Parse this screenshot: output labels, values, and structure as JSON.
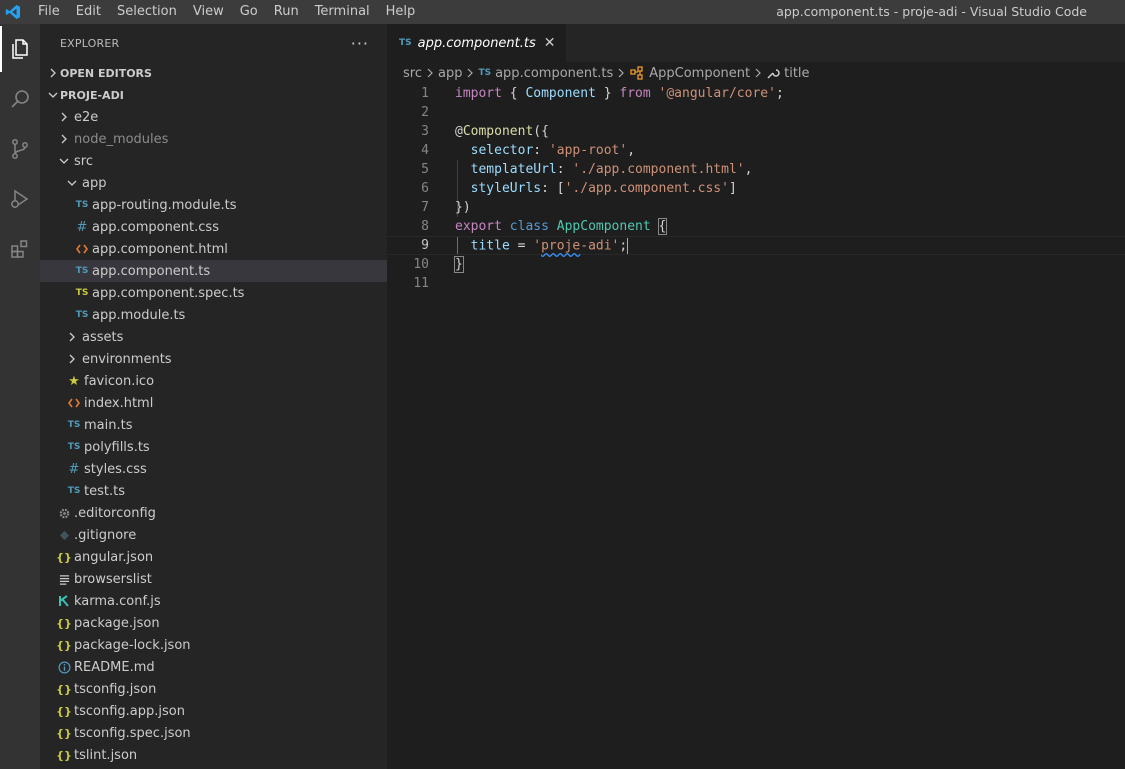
{
  "window": {
    "title": "app.component.ts - proje-adi - Visual Studio Code"
  },
  "menu": [
    "File",
    "Edit",
    "Selection",
    "View",
    "Go",
    "Run",
    "Terminal",
    "Help"
  ],
  "colors": {
    "accent": "#007acc",
    "ts": "#519aba",
    "json": "#cbcb41",
    "html": "#e37933"
  },
  "sidebar": {
    "title": "EXPLORER",
    "more": "···",
    "open_editors": "OPEN EDITORS",
    "project": "PROJE-ADI",
    "tree": [
      {
        "label": "e2e",
        "type": "folder",
        "depth": 0,
        "open": false
      },
      {
        "label": "node_modules",
        "type": "folder",
        "depth": 0,
        "open": false,
        "dim": true
      },
      {
        "label": "src",
        "type": "folder",
        "depth": 0,
        "open": true
      },
      {
        "label": "app",
        "type": "folder",
        "depth": 1,
        "open": true
      },
      {
        "label": "app-routing.module.ts",
        "type": "ts",
        "depth": 2
      },
      {
        "label": "app.component.css",
        "type": "css",
        "depth": 2
      },
      {
        "label": "app.component.html",
        "type": "html",
        "depth": 2
      },
      {
        "label": "app.component.ts",
        "type": "ts",
        "depth": 2,
        "selected": true
      },
      {
        "label": "app.component.spec.ts",
        "type": "spec",
        "depth": 2
      },
      {
        "label": "app.module.ts",
        "type": "ts",
        "depth": 2
      },
      {
        "label": "assets",
        "type": "folder",
        "depth": 1,
        "open": false
      },
      {
        "label": "environments",
        "type": "folder",
        "depth": 1,
        "open": false
      },
      {
        "label": "favicon.ico",
        "type": "star",
        "depth": 1
      },
      {
        "label": "index.html",
        "type": "html",
        "depth": 1
      },
      {
        "label": "main.ts",
        "type": "ts",
        "depth": 1
      },
      {
        "label": "polyfills.ts",
        "type": "ts",
        "depth": 1
      },
      {
        "label": "styles.css",
        "type": "css",
        "depth": 1
      },
      {
        "label": "test.ts",
        "type": "ts",
        "depth": 1
      },
      {
        "label": ".editorconfig",
        "type": "gear",
        "depth": 0
      },
      {
        "label": ".gitignore",
        "type": "git",
        "depth": 0
      },
      {
        "label": "angular.json",
        "type": "json",
        "depth": 0
      },
      {
        "label": "browserslist",
        "type": "lines",
        "depth": 0
      },
      {
        "label": "karma.conf.js",
        "type": "karma",
        "depth": 0
      },
      {
        "label": "package.json",
        "type": "json",
        "depth": 0
      },
      {
        "label": "package-lock.json",
        "type": "json",
        "depth": 0
      },
      {
        "label": "README.md",
        "type": "info",
        "depth": 0
      },
      {
        "label": "tsconfig.json",
        "type": "json",
        "depth": 0
      },
      {
        "label": "tsconfig.app.json",
        "type": "json",
        "depth": 0
      },
      {
        "label": "tsconfig.spec.json",
        "type": "json",
        "depth": 0
      },
      {
        "label": "tslint.json",
        "type": "json",
        "depth": 0
      }
    ]
  },
  "editor": {
    "tab": {
      "badge": "TS",
      "label": "app.component.ts",
      "close": "✕"
    },
    "breadcrumbs": {
      "p1": "src",
      "p2": "app",
      "badge": "TS",
      "p3": "app.component.ts",
      "p4": "AppComponent",
      "p5": "title"
    },
    "line_numbers": [
      "1",
      "2",
      "3",
      "4",
      "5",
      "6",
      "7",
      "8",
      "9",
      "10",
      "11"
    ]
  }
}
